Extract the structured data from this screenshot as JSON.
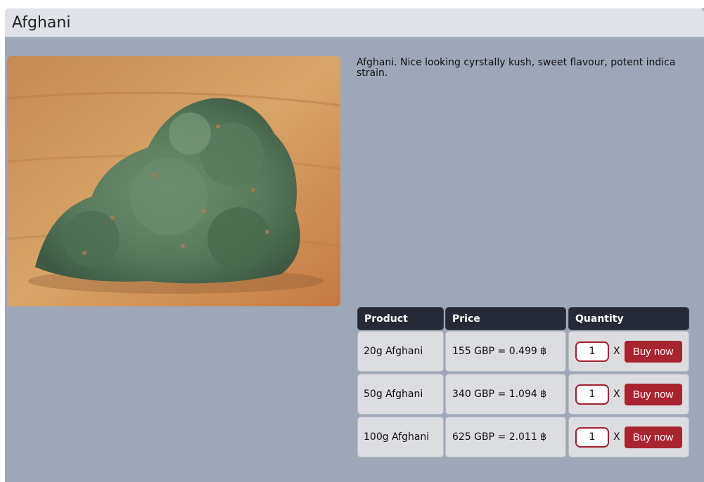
{
  "product": {
    "title": "Afghani",
    "description": "Afghani. Nice looking cyrstally kush, sweet flavour, potent indica strain.",
    "image_icon": "product-photo"
  },
  "table": {
    "headers": {
      "product": "Product",
      "price": "Price",
      "quantity": "Quantity"
    },
    "rows": [
      {
        "product": "20g Afghani",
        "price": "155 GBP = 0.499 ฿",
        "quantity": "1",
        "times": "X",
        "buy_label": "Buy now"
      },
      {
        "product": "50g Afghani",
        "price": "340 GBP = 1.094 ฿",
        "quantity": "1",
        "times": "X",
        "buy_label": "Buy now"
      },
      {
        "product": "100g Afghani",
        "price": "625 GBP = 2.011 ฿",
        "quantity": "1",
        "times": "X",
        "buy_label": "Buy now"
      }
    ]
  },
  "colors": {
    "panel": "#9da7b8",
    "header": "#dfe2e8",
    "table_header": "#252a36",
    "accent": "#a8242f"
  }
}
